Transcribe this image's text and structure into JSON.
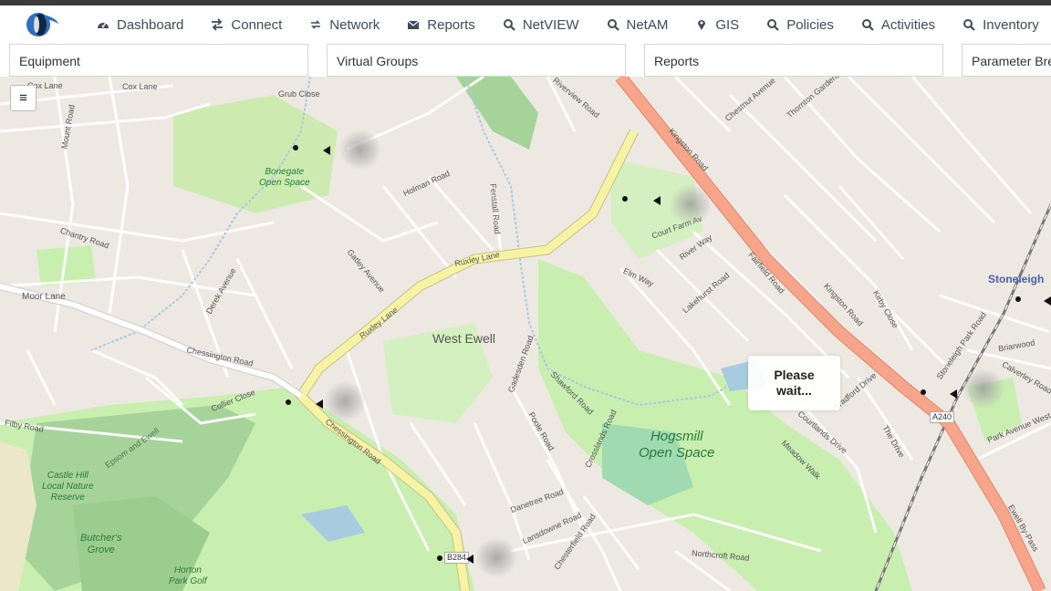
{
  "nav": {
    "items": [
      {
        "label": "Dashboard",
        "icon": "dashboard-icon"
      },
      {
        "label": "Connect",
        "icon": "arrows-exchange-icon"
      },
      {
        "label": "Network",
        "icon": "network-arrows-icon"
      },
      {
        "label": "Reports",
        "icon": "envelope-icon"
      },
      {
        "label": "NetVIEW",
        "icon": "search-icon"
      },
      {
        "label": "NetAM",
        "icon": "search-icon"
      },
      {
        "label": "GIS",
        "icon": "map-pin-icon"
      },
      {
        "label": "Policies",
        "icon": "search-icon"
      },
      {
        "label": "Activities",
        "icon": "search-icon"
      },
      {
        "label": "Inventory",
        "icon": "search-icon"
      }
    ]
  },
  "panels": [
    {
      "label": "Equipment"
    },
    {
      "label": "Virtual Groups"
    },
    {
      "label": "Reports"
    },
    {
      "label": "Parameter Bre"
    }
  ],
  "map": {
    "loading_text": "Please\nwait...",
    "menu_icon": "≡",
    "places": {
      "west_ewell": "West Ewell",
      "stoneleigh": "Stoneleigh",
      "hogsmill": "Hogsmill\nOpen Space",
      "bonegate": "Bonegate\nOpen Space",
      "castle_hill": "Castle Hill\nLocal Nature\nReserve",
      "butchers_grove": "Butcher's\nGrove",
      "horton": "Horton\nPark Golf"
    },
    "road_badges": {
      "a240": "A240",
      "b284": "B284"
    },
    "roads": {
      "cox_lane_a": "Cox Lane",
      "cox_lane_b": "Cox Lane",
      "moor_lane": "Moor Lane",
      "chessington_road": "Chessington Road",
      "chessington_road_b": "Chessington Road",
      "ruxley_lane": "Ruxley Lane",
      "ruxley_lane_b": "Ruxley Lane",
      "kingston_road": "Kingston Road",
      "kingston_road_b": "Kingston Road",
      "grub_close": "Grub Close",
      "ewell_bypass": "Ewell By-Pass",
      "riverview_road": "Riverview Road",
      "chestnut_avenue": "Chestnut Avenue",
      "thornton_gardens": "Thornton Gardens",
      "elm_way": "Elm Way",
      "river_way": "River Way",
      "court_farm": "Court Farm Av",
      "lakehurst_road": "Lakehurst Road",
      "fairfield_road": "Fairfield Road",
      "bradford_drive": "Bradford Drive",
      "the_drive": "The Drive",
      "park_avenue_west": "Park Avenue West",
      "calverley_road": "Calverley Road",
      "northcroft_road": "Northcroft Road",
      "poole_road": "Poole Road",
      "holman_road": "Holman Road",
      "mount_road": "Mount Road",
      "chantry_road": "Chantry Road",
      "fenstall_road": "Fenstall Road",
      "gadesden_road": "Gadesden Road",
      "collier_close": "Collier Close",
      "filby_road": "Filby Road",
      "derek_avenue": "Derek Avenue",
      "gatley_avenue": "Gatley Avenue",
      "shawford_road": "Shawford Road",
      "crosslands_road": "Crosslands Road",
      "danetree_road": "Danetree Road",
      "lansdowne_road": "Lansdowne Road",
      "chesterfield_road": "Chesterfield Road",
      "meadow_walk": "Meadow Walk",
      "courtlands_drive": "Courtlands Drive",
      "kirby_close": "Kirby Close",
      "stoneleigh_park_road": "Stoneleigh Park Road",
      "briarwood": "Briarwood",
      "epsom_ewell": "Epsom and Ewell"
    }
  },
  "colors": {
    "major_road": "#f7a58a",
    "secondary_road": "#f4f1a4",
    "park": "#c8eeb0",
    "wood": "#a5d39a",
    "water": "#a8cbe0",
    "nav_text": "#3d4b5c"
  }
}
